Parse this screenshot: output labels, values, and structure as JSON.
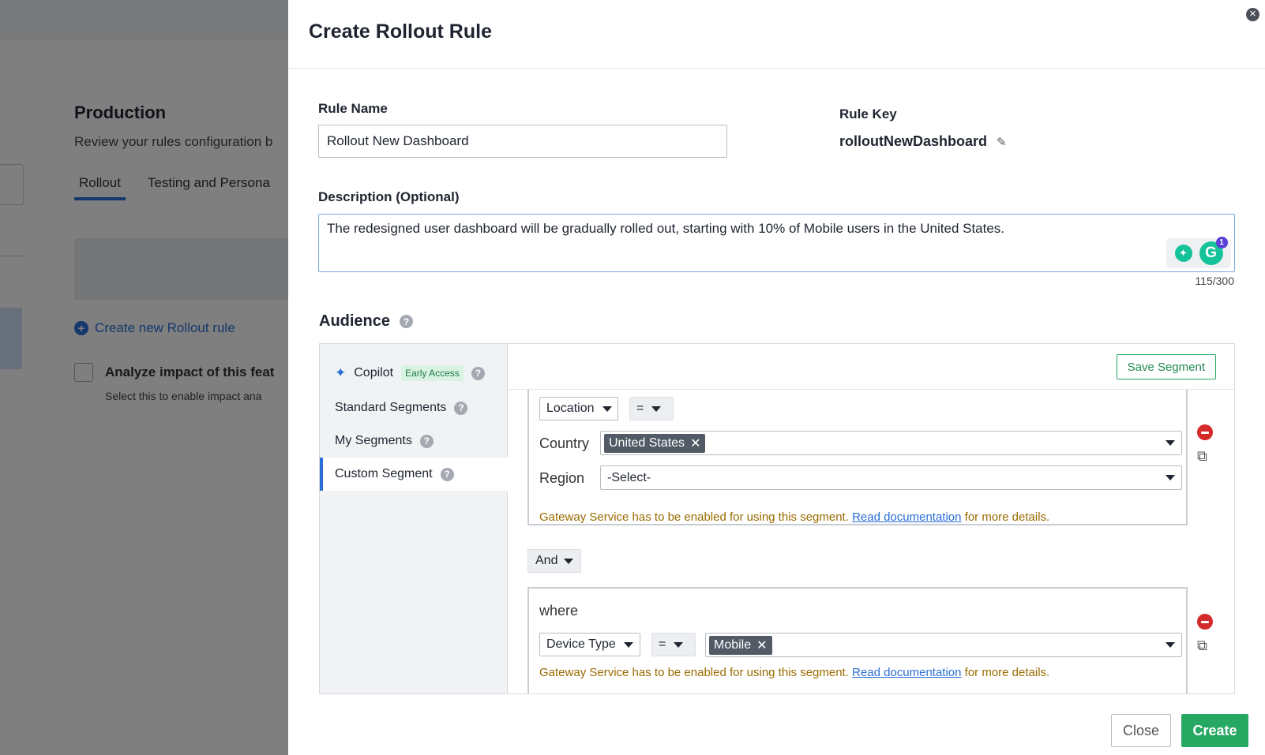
{
  "background": {
    "title": "Production",
    "subtitle": "Review your rules configuration b",
    "tabs": [
      "Rollout",
      "Testing and Persona"
    ],
    "create_link": "Create new Rollout rule",
    "analyze_label": "Analyze impact of this feat",
    "analyze_sub": "Select this to enable impact ana"
  },
  "modal": {
    "title": "Create Rollout Rule",
    "rule_name_label": "Rule Name",
    "rule_name_value": "Rollout New Dashboard",
    "rule_key_label": "Rule Key",
    "rule_key_value": "rolloutNewDashboard",
    "description_label": "Description (Optional)",
    "description_value": "The redesigned user dashboard will be gradually rolled out, starting with 10% of Mobile users in the United States.",
    "char_counter": "115/300",
    "grammarly_badge": "1",
    "audience_title": "Audience"
  },
  "audience": {
    "sidebar": [
      {
        "label": "Copilot",
        "badge": "Early Access"
      },
      {
        "label": "Standard Segments"
      },
      {
        "label": "My Segments"
      },
      {
        "label": "Custom Segment"
      }
    ],
    "save_segment_label": "Save Segment",
    "segment1": {
      "attribute": "Location",
      "operator": "=",
      "country_label": "Country",
      "country_value": "United States",
      "region_label": "Region",
      "region_value": "-Select-",
      "note_prefix": "Gateway Service has to be enabled for using this segment.",
      "note_link": "Read documentation",
      "note_suffix": "for more details."
    },
    "combinator": "And",
    "segment2": {
      "where_label": "where",
      "attribute": "Device Type",
      "operator": "=",
      "value": "Mobile",
      "note_prefix": "Gateway Service has to be enabled for using this segment.",
      "note_link": "Read documentation",
      "note_suffix": "for more details."
    }
  },
  "footer": {
    "close_label": "Close",
    "create_label": "Create"
  },
  "colors": {
    "accent": "#2a6fd6",
    "success": "#27a862",
    "danger": "#d42a2a",
    "warning_text": "#9a6b00"
  }
}
